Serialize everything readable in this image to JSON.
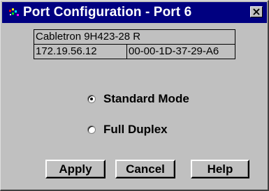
{
  "window": {
    "title": "Port Configuration - Port 6",
    "close_label": "×",
    "app_icon": "network-app-icon"
  },
  "device_info": {
    "model": "Cabletron 9H423-28 R",
    "ip_address": "172.19.56.12",
    "mac_address": "00-00-1D-37-29-A6"
  },
  "mode": {
    "options": [
      {
        "label": "Standard Mode",
        "selected": true
      },
      {
        "label": "Full Duplex",
        "selected": false
      }
    ]
  },
  "buttons": {
    "apply": "Apply",
    "cancel": "Cancel",
    "help": "Help"
  },
  "colors": {
    "titlebar": "#000080",
    "face": "#c0c0c0"
  }
}
